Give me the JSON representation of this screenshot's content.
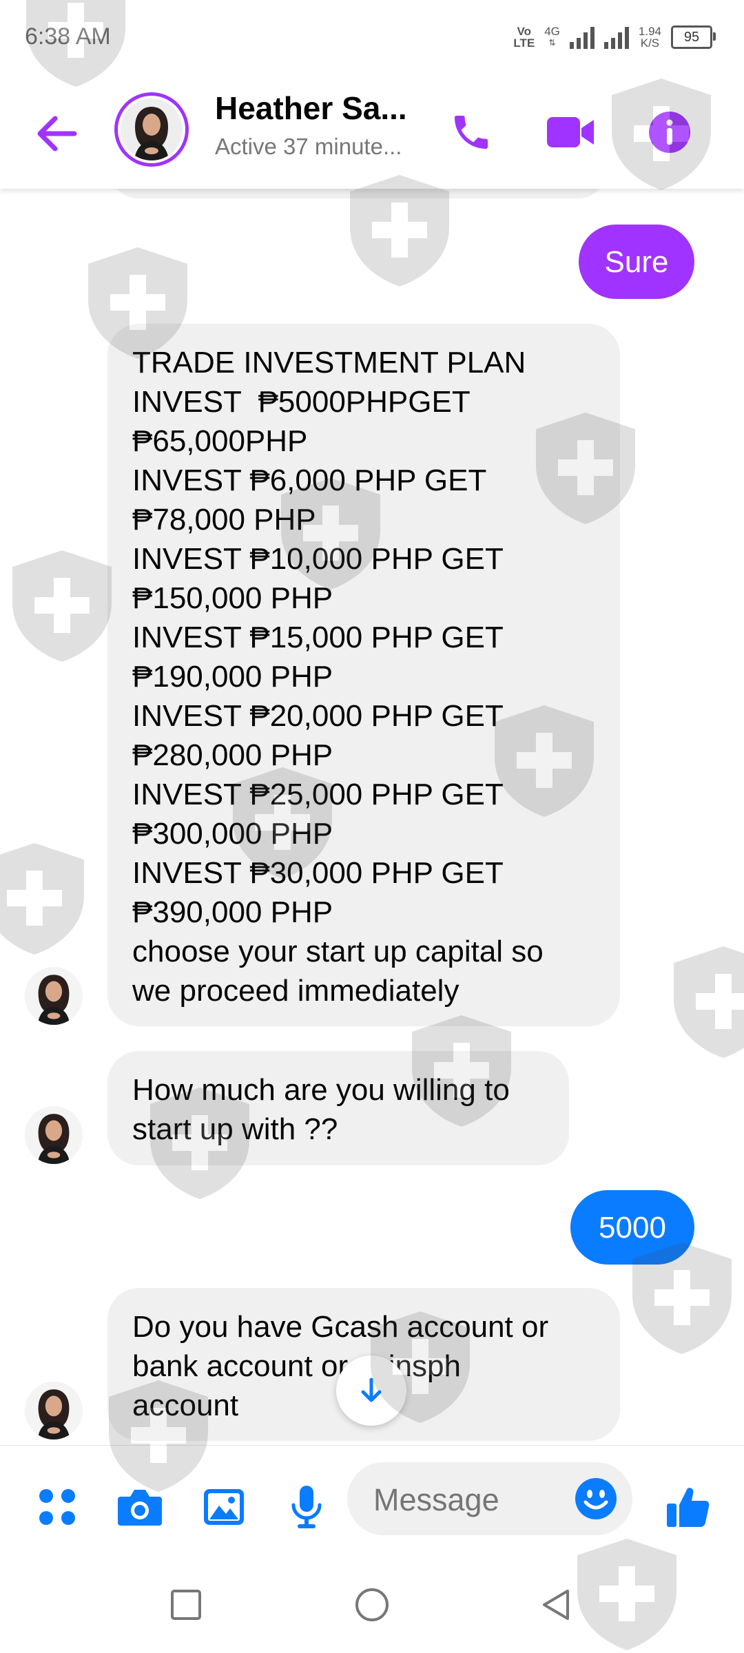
{
  "status_bar": {
    "time": "6:38 AM",
    "volte_top": "Vo",
    "volte_bottom": "LTE",
    "network": "4G",
    "speed_value": "1.94",
    "speed_unit": "K/S",
    "battery": "95"
  },
  "header": {
    "contact_name": "Heather Sa...",
    "contact_status": "Active 37 minute..."
  },
  "messages": {
    "m1": "Sure",
    "m2_lines": [
      "TRADE INVESTMENT PLAN",
      "INVEST  ₱5000PHPGET",
      "₱65,000PHP",
      "INVEST ₱6,000 PHP GET",
      "₱78,000 PHP",
      "INVEST ₱10,000 PHP GET",
      "₱150,000 PHP",
      "INVEST ₱15,000 PHP GET",
      "₱190,000 PHP",
      "INVEST ₱20,000 PHP GET",
      "₱280,000 PHP",
      "INVEST ₱25,000 PHP GET",
      "₱300,000 PHP",
      "INVEST ₱30,000 PHP GET",
      "₱390,000 PHP",
      "choose your start up capital so",
      "we proceed immediately"
    ],
    "m3_lines": [
      "How much are you willing to",
      "start up with ??"
    ],
    "m4": "5000",
    "m5_lines": [
      "Do you have Gcash account or",
      "bank account or coinsph",
      "account"
    ]
  },
  "composer": {
    "placeholder": "Message"
  },
  "colors": {
    "accent_purple": "#a033ff",
    "accent_blue": "#0a7cff",
    "incoming_bubble": "#f0f0f0"
  },
  "icons": {
    "back": "arrow-left-icon",
    "call": "phone-icon",
    "video": "video-camera-icon",
    "info": "info-icon",
    "menu": "four-dots-icon",
    "camera": "camera-icon",
    "gallery": "image-icon",
    "mic": "microphone-icon",
    "emoji": "smiley-icon",
    "like": "thumbs-up-icon",
    "scroll": "arrow-down-icon"
  }
}
